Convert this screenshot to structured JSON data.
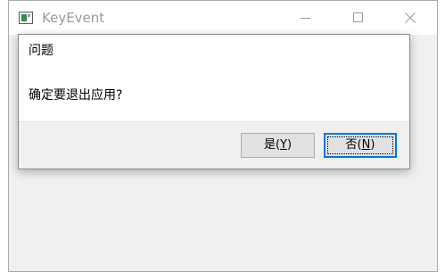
{
  "window": {
    "title": "KeyEvent"
  },
  "dialog": {
    "title": "问题",
    "message": "确定要退出应用?",
    "buttons": {
      "yes": {
        "label_prefix": "是(",
        "mnemonic": "Y",
        "label_suffix": ")"
      },
      "no": {
        "label_prefix": "否(",
        "mnemonic": "N",
        "label_suffix": ")"
      }
    },
    "default_button": "no"
  },
  "colors": {
    "focus_border": "#0078d7",
    "window_bg": "#f0f0f0",
    "title_text": "#9a9a9a"
  },
  "icons": {
    "app": "app-window-icon",
    "minimize": "minimize-icon",
    "maximize": "maximize-icon",
    "close": "close-icon"
  }
}
